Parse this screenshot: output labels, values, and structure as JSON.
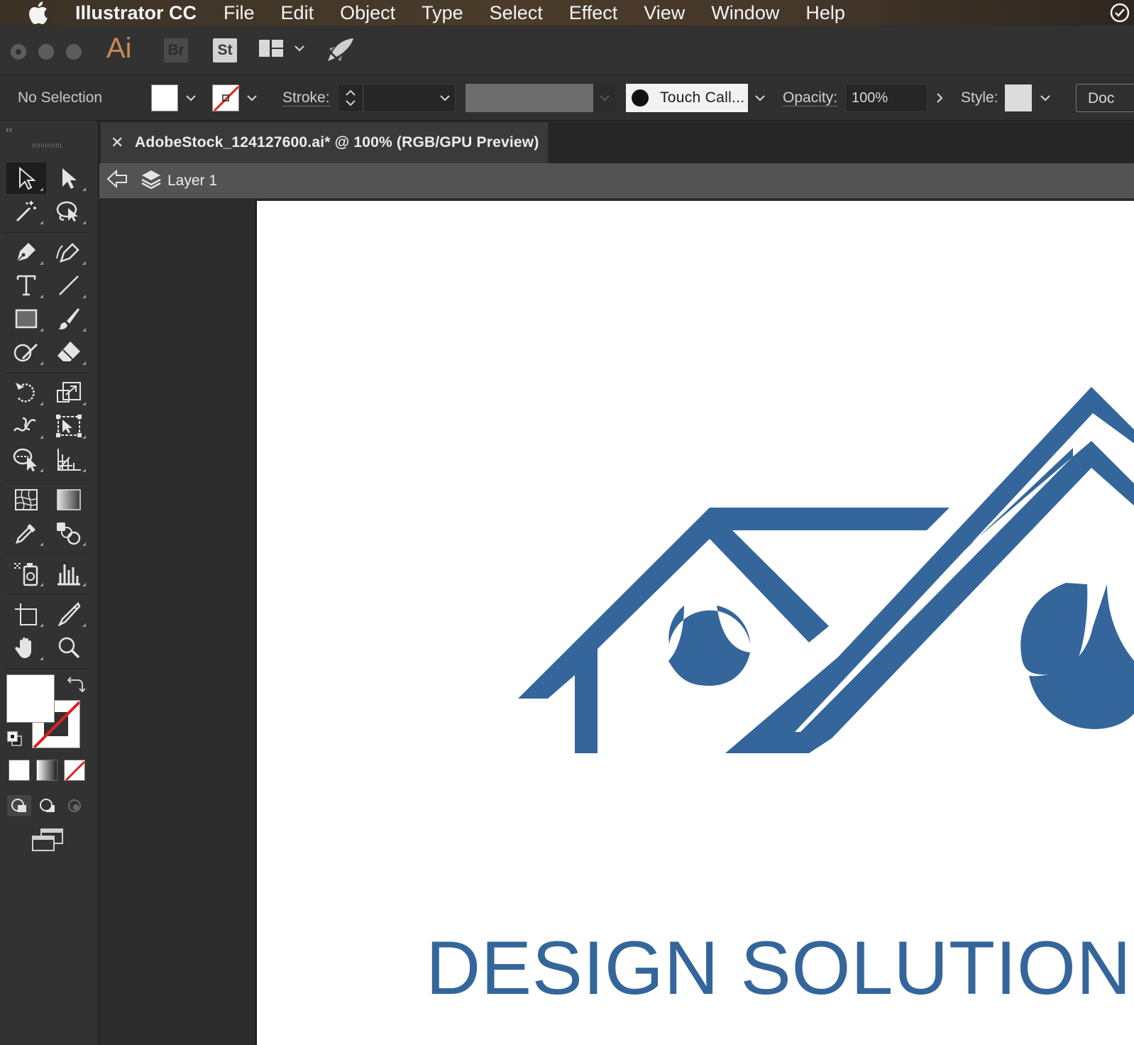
{
  "menubar": {
    "app_name": "Illustrator CC",
    "items": [
      "File",
      "Edit",
      "Object",
      "Type",
      "Select",
      "Effect",
      "View",
      "Window",
      "Help"
    ]
  },
  "appbar": {
    "ai_logo": "Ai",
    "bridge_logo": "Br",
    "stock_logo": "St"
  },
  "controlbar": {
    "selection_label": "No Selection",
    "stroke_label": "Stroke:",
    "brush_definition": "Touch Call...",
    "opacity_label": "Opacity:",
    "opacity_value": "100%",
    "style_label": "Style:",
    "document_setup_label": "Doc"
  },
  "document": {
    "tab_title": "AdobeStock_124127600.ai* @ 100% (RGB/GPU Preview)",
    "layer_label": "Layer 1"
  },
  "artwork": {
    "brand_text": "DESIGN SOLUTION",
    "logo_color": "#34669b"
  },
  "colors": {
    "accent_logo": "#34669b",
    "ui_dark": "#323232",
    "ai_orange": "#c98a54",
    "no_stroke_red": "#e0201f"
  }
}
